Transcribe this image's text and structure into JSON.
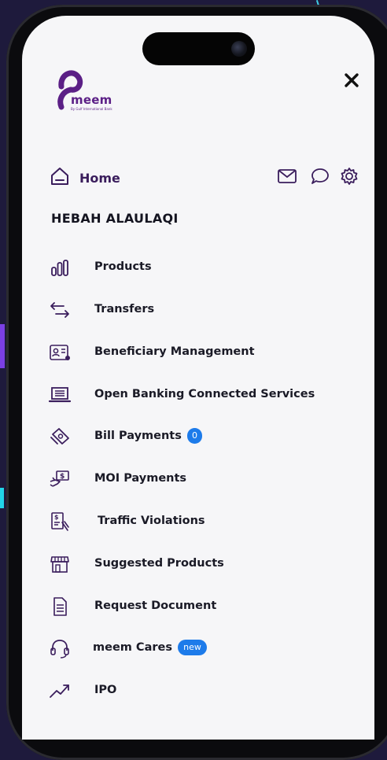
{
  "logo": {
    "name": "meem",
    "subtitle": "By Gulf International Bank"
  },
  "header": {
    "home_label": "Home"
  },
  "user": {
    "name": "HEBAH ALAULAQI"
  },
  "menu": {
    "items": [
      {
        "label": "Products",
        "icon": "bar-chart-icon"
      },
      {
        "label": "Transfers",
        "icon": "transfer-arrows-icon"
      },
      {
        "label": "Beneficiary Management",
        "icon": "id-card-icon"
      },
      {
        "label": "Open Banking Connected Services",
        "icon": "laptop-icon"
      },
      {
        "label": "Bill Payments",
        "icon": "bill-icon",
        "badge": "0"
      },
      {
        "label": "MOI Payments",
        "icon": "hand-money-icon"
      },
      {
        "label": "Traffic Violations",
        "icon": "ticket-icon"
      },
      {
        "label": "Suggested Products",
        "icon": "storefront-icon"
      },
      {
        "label": "Request Document",
        "icon": "document-icon"
      },
      {
        "label": "meem Cares",
        "icon": "headset-icon",
        "badge": "new"
      },
      {
        "label": "IPO",
        "icon": "trend-up-icon"
      }
    ]
  },
  "colors": {
    "brand": "#5b1f86",
    "badge": "#1d7bea",
    "screen": "#f6f6f8",
    "text": "#1a1a26"
  }
}
